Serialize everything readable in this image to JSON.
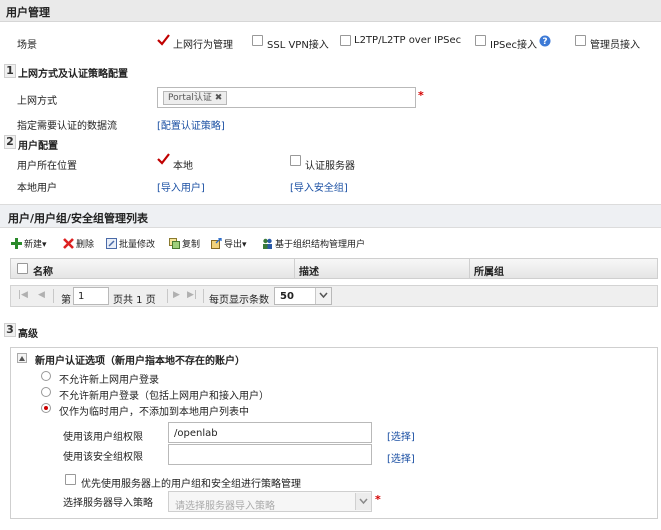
{
  "header": {
    "title": "用户管理"
  },
  "scene": {
    "label": "场景",
    "options": [
      {
        "label": "上网行为管理",
        "checked": true
      },
      {
        "label": "SSL VPN接入",
        "checked": false
      },
      {
        "label": "L2TP/L2TP over IPSec",
        "checked": false
      },
      {
        "label": "IPSec接入",
        "checked": false
      },
      {
        "label": "管理员接入",
        "checked": false
      }
    ],
    "help_icon": "question-icon"
  },
  "section1": {
    "num": "1",
    "title": "上网方式及认证策略配置",
    "access_label": "上网方式",
    "access_tag": "Portal认证",
    "flow_label": "指定需要认证的数据流",
    "flow_link": "[配置认证策略]"
  },
  "section2": {
    "num": "2",
    "title": "用户配置",
    "location_label": "用户所在位置",
    "local_label": "本地",
    "auth_server_label": "认证服务器",
    "local_user_label": "本地用户",
    "import_users": "[导入用户]",
    "import_groups": "[导入安全组]"
  },
  "list_panel": {
    "title": "用户/用户组/安全组管理列表",
    "toolbar": {
      "new": "新建▾",
      "delete": "删除",
      "batch_edit": "批量修改",
      "copy": "复制",
      "export": "导出▾",
      "org_manage": "基于组织结构管理用户"
    },
    "columns": [
      "名称",
      "描述",
      "所属组"
    ],
    "pager": {
      "page_label": "第",
      "page_value": "1",
      "page_total": "页共 1 页",
      "per_page_label": "每页显示条数",
      "per_page_value": "50"
    }
  },
  "section3": {
    "num": "3",
    "title": "高级",
    "fieldset_title": "新用户认证选项（新用户指本地不存在的账户）",
    "radios": [
      {
        "label": "不允许新上网用户登录",
        "selected": false
      },
      {
        "label": "不允许新用户登录（包括上网用户和接入用户）",
        "selected": false
      },
      {
        "label": "仅作为临时用户，不添加到本地用户列表中",
        "selected": true
      }
    ],
    "user_group_label": "使用该用户组权限",
    "user_group_value": "/openlab",
    "user_group_select": "[选择]",
    "security_group_label": "使用该安全组权限",
    "security_group_value": "",
    "security_group_select": "[选择]",
    "prefer_server_label": "优先使用服务器上的用户组和安全组进行策略管理",
    "import_policy_label": "选择服务器导入策略",
    "import_policy_placeholder": "请选择服务器导入策略"
  },
  "colors": {
    "link": "#1a4fa3",
    "required": "#d40000",
    "check": "#c00000"
  }
}
